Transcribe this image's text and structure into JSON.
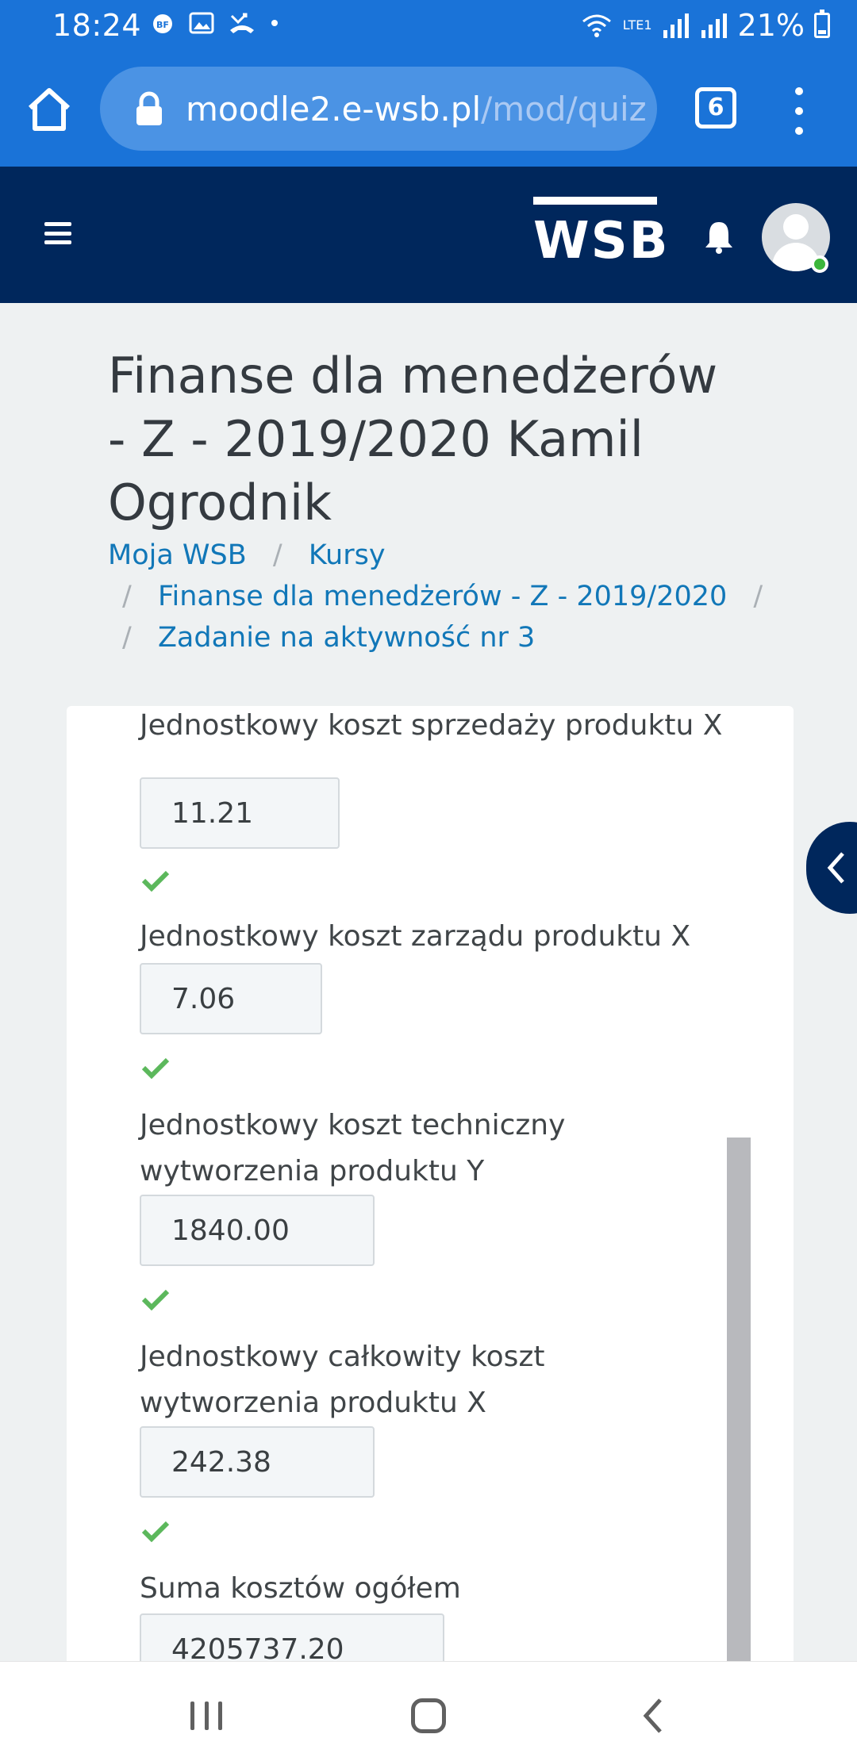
{
  "status_bar": {
    "time": "18:24",
    "battery": "21%",
    "network": "LTE1"
  },
  "browser": {
    "url_host": "moodle2.e-wsb.pl",
    "url_path": "/mod/quiz",
    "tab_count": "6"
  },
  "navbar": {
    "logo_text": "WSB"
  },
  "page": {
    "title": "Finanse dla menedżerów - Z - 2019/2020 Kamil Ogrodnik",
    "breadcrumbs": [
      "Moja WSB",
      "Kursy",
      "Finanse dla menedżerów - Z - 2019/2020",
      "Zadanie na aktywność nr 3"
    ],
    "separator": "/"
  },
  "quiz": {
    "fields": [
      {
        "label": "Jednostkowy koszt sprzedaży produktu X",
        "value": "11.21",
        "correct": true
      },
      {
        "label": "Jednostkowy koszt zarządu produktu X",
        "value": "7.06",
        "correct": true
      },
      {
        "label": "Jednostkowy koszt techniczny wytworzenia produktu Y",
        "value": "1840.00",
        "correct": true
      },
      {
        "label": "Jednostkowy całkowity koszt wytworzenia produktu X",
        "value": "242.38",
        "correct": true
      },
      {
        "label": "Suma kosztów ogółem",
        "value": "4205737.20"
      }
    ]
  },
  "colors": {
    "chrome_blue": "#1a73d8",
    "nav_navy": "#00275c",
    "link": "#1177b8",
    "check_green": "#5cb85c"
  }
}
